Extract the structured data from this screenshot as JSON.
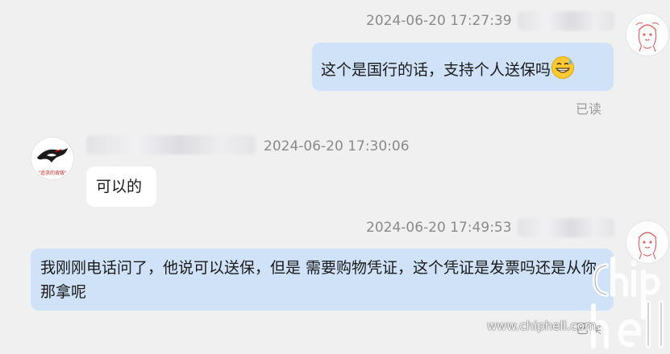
{
  "messages": [
    {
      "side": "right",
      "timestamp": "2024-06-20 17:27:39",
      "text": "这个是国行的话，支持个人送保吗",
      "emoji": "grinning-sweat-face",
      "status": "已读"
    },
    {
      "side": "left",
      "timestamp": "2024-06-20 17:30:06",
      "text": "可以的"
    },
    {
      "side": "right",
      "timestamp": "2024-06-20 17:49:53",
      "text": "我刚刚电话问了，他说可以送保，但是 需要购物凭证，这个凭证是发票吗还是从你那拿呢",
      "status": "已读"
    }
  ],
  "avatars": {
    "me_icon": "anime-girl-sketch-avatar",
    "other_icon": "rog-logo-avatar",
    "other_caption": "\"追求的背叛\""
  },
  "watermark": {
    "logo_text": "chip hell",
    "url": "www.chiphell.com"
  },
  "colors": {
    "background": "#f0f0f0",
    "my_bubble": "#cfe2f7",
    "their_bubble": "#ffffff",
    "meta_text": "#8a8a8a"
  }
}
